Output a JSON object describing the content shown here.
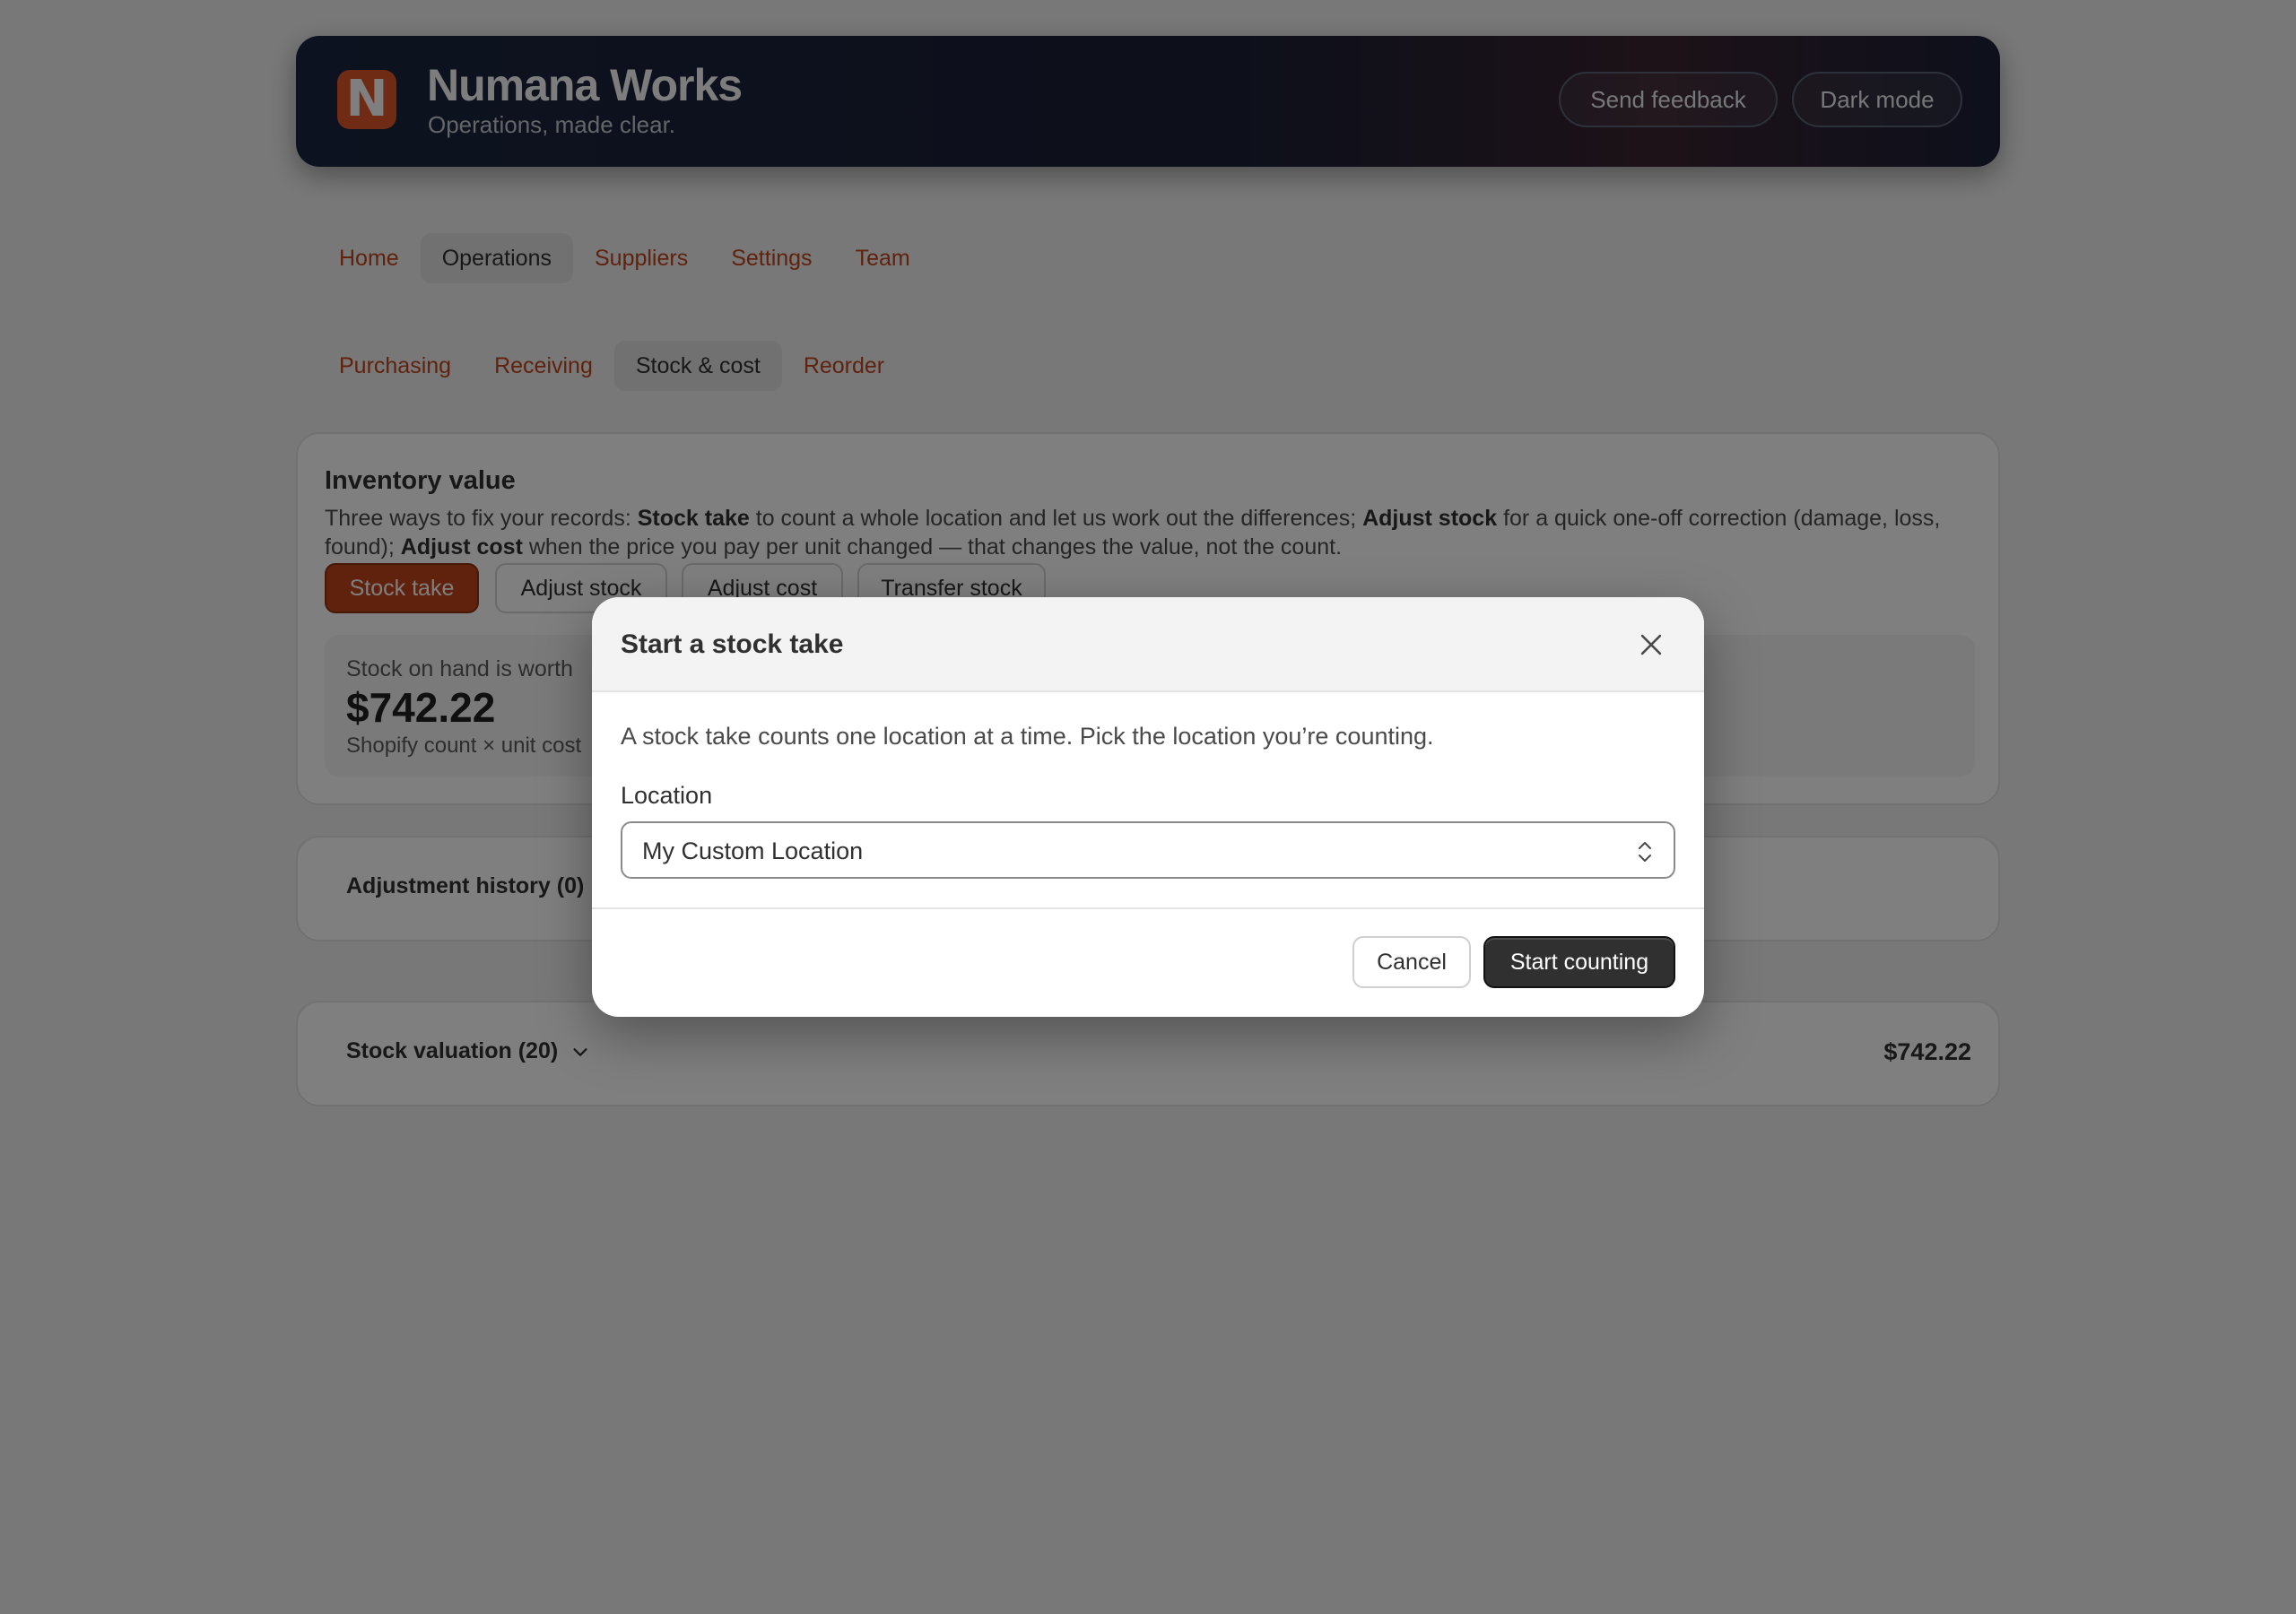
{
  "header": {
    "logo_letter": "N",
    "brand_title": "Numana Works",
    "brand_subtitle": "Operations, made clear.",
    "feedback_label": "Send feedback",
    "dark_mode_label": "Dark mode"
  },
  "nav": {
    "items": [
      {
        "label": "Home"
      },
      {
        "label": "Operations",
        "active": true
      },
      {
        "label": "Suppliers"
      },
      {
        "label": "Settings"
      },
      {
        "label": "Team"
      }
    ]
  },
  "subnav": {
    "items": [
      {
        "label": "Purchasing"
      },
      {
        "label": "Receiving"
      },
      {
        "label": "Stock & cost",
        "active": true
      },
      {
        "label": "Reorder"
      }
    ]
  },
  "inventory": {
    "title": "Inventory value",
    "desc_1": "Three ways to fix your records: ",
    "desc_b1": "Stock take",
    "desc_2": " to count a whole location and let us work out the differences; ",
    "desc_b2": "Adjust stock",
    "desc_3": " for a quick one-off correction (damage, loss, found); ",
    "desc_b3": "Adjust cost",
    "desc_4": " when the price you pay per unit changed — that changes the value, not the count.",
    "buttons": {
      "stock_take": "Stock take",
      "adjust_stock": "Adjust stock",
      "adjust_cost": "Adjust cost",
      "transfer_stock": "Transfer stock"
    },
    "worth_label": "Stock on hand is worth",
    "worth_value": "$742.22",
    "worth_sub": "Shopify count × unit cost"
  },
  "history": {
    "label": "Adjustment history (0)"
  },
  "valuation": {
    "label": "Stock valuation (20)",
    "value": "$742.22"
  },
  "modal": {
    "title": "Start a stock take",
    "description": "A stock take counts one location at a time. Pick the location you’re counting.",
    "location_label": "Location",
    "location_value": "My Custom Location",
    "cancel_label": "Cancel",
    "start_label": "Start counting"
  },
  "colors": {
    "accent": "#c0441a",
    "logo": "#e0562a",
    "primary_button": "#303030"
  }
}
